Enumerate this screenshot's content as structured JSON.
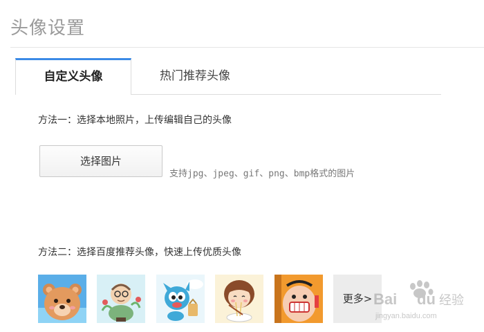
{
  "header": {
    "title": "头像设置"
  },
  "tabs": [
    {
      "label": "自定义头像",
      "active": true
    },
    {
      "label": "热门推荐头像",
      "active": false
    }
  ],
  "method1": {
    "text": "方法一：选择本地照片，上传编辑自己的头像",
    "button_label": "选择图片",
    "support_text": "支持jpg、jpeg、gif、png、bmp格式的图片"
  },
  "method2": {
    "text": "方法二：选择百度推荐头像，快速上传优质头像",
    "avatars": [
      "bear",
      "old-man",
      "blue-cartoon",
      "girl-noodles",
      "chef-smile"
    ],
    "more_label": "更多>"
  },
  "watermark": {
    "brand": "Bai du 经验",
    "url": "jingyan.baidu.com"
  },
  "colors": {
    "accent": "#3b8ae6",
    "title_gray": "#9a9a9a",
    "border": "#dcdcdc"
  }
}
